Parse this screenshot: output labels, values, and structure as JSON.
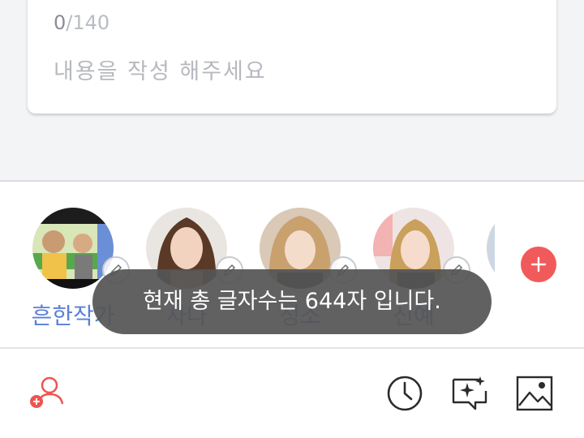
{
  "editor": {
    "char_count_current": "0",
    "char_count_max": "/140",
    "content_placeholder": "내용을 작성 해주세요"
  },
  "profiles": [
    {
      "name": "흔한작가",
      "avatar": "profile-avatar-1"
    },
    {
      "name": "사나",
      "avatar": "profile-avatar-2"
    },
    {
      "name": "성소",
      "avatar": "profile-avatar-3"
    },
    {
      "name": "신예",
      "avatar": "profile-avatar-4"
    }
  ],
  "toast": {
    "message": "현재 총 글자수는 644자 입니다."
  },
  "toolbar": {
    "icons": [
      "add-person-icon",
      "clock-icon",
      "sparkle-comment-icon",
      "image-icon"
    ]
  },
  "colors": {
    "accent_red": "#f15a5a",
    "name_blue": "#5a7fd8",
    "toast_bg": "#555555"
  }
}
